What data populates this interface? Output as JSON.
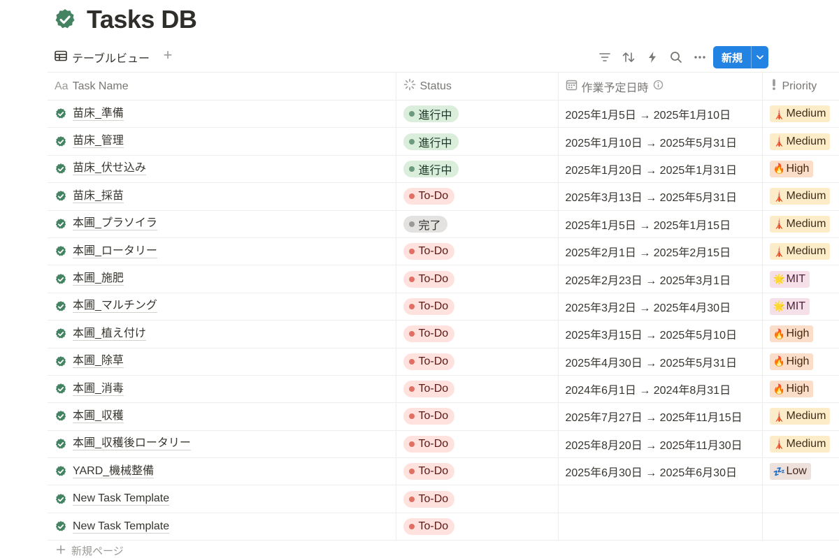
{
  "page": {
    "title": "Tasks DB",
    "icon": "check-badge-icon"
  },
  "view": {
    "tab_label": "テーブルビュー",
    "tab_icon": "table-icon",
    "add_label": "+"
  },
  "toolbar": {
    "icons": [
      "filter-icon",
      "sort-icon",
      "automation-icon",
      "search-icon",
      "more-icon"
    ],
    "new_button_label": "新規"
  },
  "columns": {
    "task": {
      "prefix": "Aa",
      "label": "Task Name"
    },
    "status": {
      "label": "Status"
    },
    "date": {
      "label": "作業予定日時"
    },
    "priority": {
      "label": "Priority"
    }
  },
  "rows": [
    {
      "name": "苗床_準備",
      "status": "進行中",
      "status_kind": "progress",
      "date": "2025年1月5日 → 2025年1月10日",
      "priority": "Medium",
      "priority_emoji": "🗼",
      "priority_kind": "medium"
    },
    {
      "name": "苗床_管理",
      "status": "進行中",
      "status_kind": "progress",
      "date": "2025年1月10日 → 2025年5月31日",
      "priority": "Medium",
      "priority_emoji": "🗼",
      "priority_kind": "medium"
    },
    {
      "name": "苗床_伏せ込み",
      "status": "進行中",
      "status_kind": "progress",
      "date": "2025年1月20日 → 2025年1月31日",
      "priority": "High",
      "priority_emoji": "🔥",
      "priority_kind": "high"
    },
    {
      "name": "苗床_採苗",
      "status": "To-Do",
      "status_kind": "todo",
      "date": "2025年3月13日 → 2025年5月31日",
      "priority": "Medium",
      "priority_emoji": "🗼",
      "priority_kind": "medium"
    },
    {
      "name": "本圃_プラソイラ",
      "status": "完了",
      "status_kind": "done",
      "date": "2025年1月5日 → 2025年1月15日",
      "priority": "Medium",
      "priority_emoji": "🗼",
      "priority_kind": "medium"
    },
    {
      "name": "本圃_ロータリー",
      "status": "To-Do",
      "status_kind": "todo",
      "date": "2025年2月1日 → 2025年2月15日",
      "priority": "Medium",
      "priority_emoji": "🗼",
      "priority_kind": "medium"
    },
    {
      "name": "本圃_施肥",
      "status": "To-Do",
      "status_kind": "todo",
      "date": "2025年2月23日 → 2025年3月1日",
      "priority": "MIT",
      "priority_emoji": "🌟",
      "priority_kind": "mit"
    },
    {
      "name": "本圃_マルチング",
      "status": "To-Do",
      "status_kind": "todo",
      "date": "2025年3月2日 → 2025年4月30日",
      "priority": "MIT",
      "priority_emoji": "🌟",
      "priority_kind": "mit"
    },
    {
      "name": "本圃_植え付け",
      "status": "To-Do",
      "status_kind": "todo",
      "date": "2025年3月15日 → 2025年5月10日",
      "priority": "High",
      "priority_emoji": "🔥",
      "priority_kind": "high"
    },
    {
      "name": "本圃_除草",
      "status": "To-Do",
      "status_kind": "todo",
      "date": "2025年4月30日 → 2025年5月31日",
      "priority": "High",
      "priority_emoji": "🔥",
      "priority_kind": "high"
    },
    {
      "name": "本圃_消毒",
      "status": "To-Do",
      "status_kind": "todo",
      "date": "2024年6月1日 → 2024年8月31日",
      "priority": "High",
      "priority_emoji": "🔥",
      "priority_kind": "high"
    },
    {
      "name": "本圃_収穫",
      "status": "To-Do",
      "status_kind": "todo",
      "date": "2025年7月27日 → 2025年11月15日",
      "priority": "Medium",
      "priority_emoji": "🗼",
      "priority_kind": "medium"
    },
    {
      "name": "本圃_収穫後ロータリー",
      "status": "To-Do",
      "status_kind": "todo",
      "date": "2025年8月20日 → 2025年11月30日",
      "priority": "Medium",
      "priority_emoji": "🗼",
      "priority_kind": "medium"
    },
    {
      "name": "YARD_機械整備",
      "status": "To-Do",
      "status_kind": "todo",
      "date": "2025年6月30日 → 2025年6月30日",
      "priority": "Low",
      "priority_emoji": "💤",
      "priority_kind": "low"
    },
    {
      "name": "New Task Template",
      "status": "To-Do",
      "status_kind": "todo",
      "date": "",
      "priority": "",
      "priority_emoji": "",
      "priority_kind": ""
    },
    {
      "name": "New Task Template",
      "status": "To-Do",
      "status_kind": "todo",
      "date": "",
      "priority": "",
      "priority_emoji": "",
      "priority_kind": ""
    }
  ],
  "footer": {
    "new_page_label": "新規ページ"
  },
  "colors": {
    "accent": "#2383e2",
    "check_icon": "#448361"
  }
}
